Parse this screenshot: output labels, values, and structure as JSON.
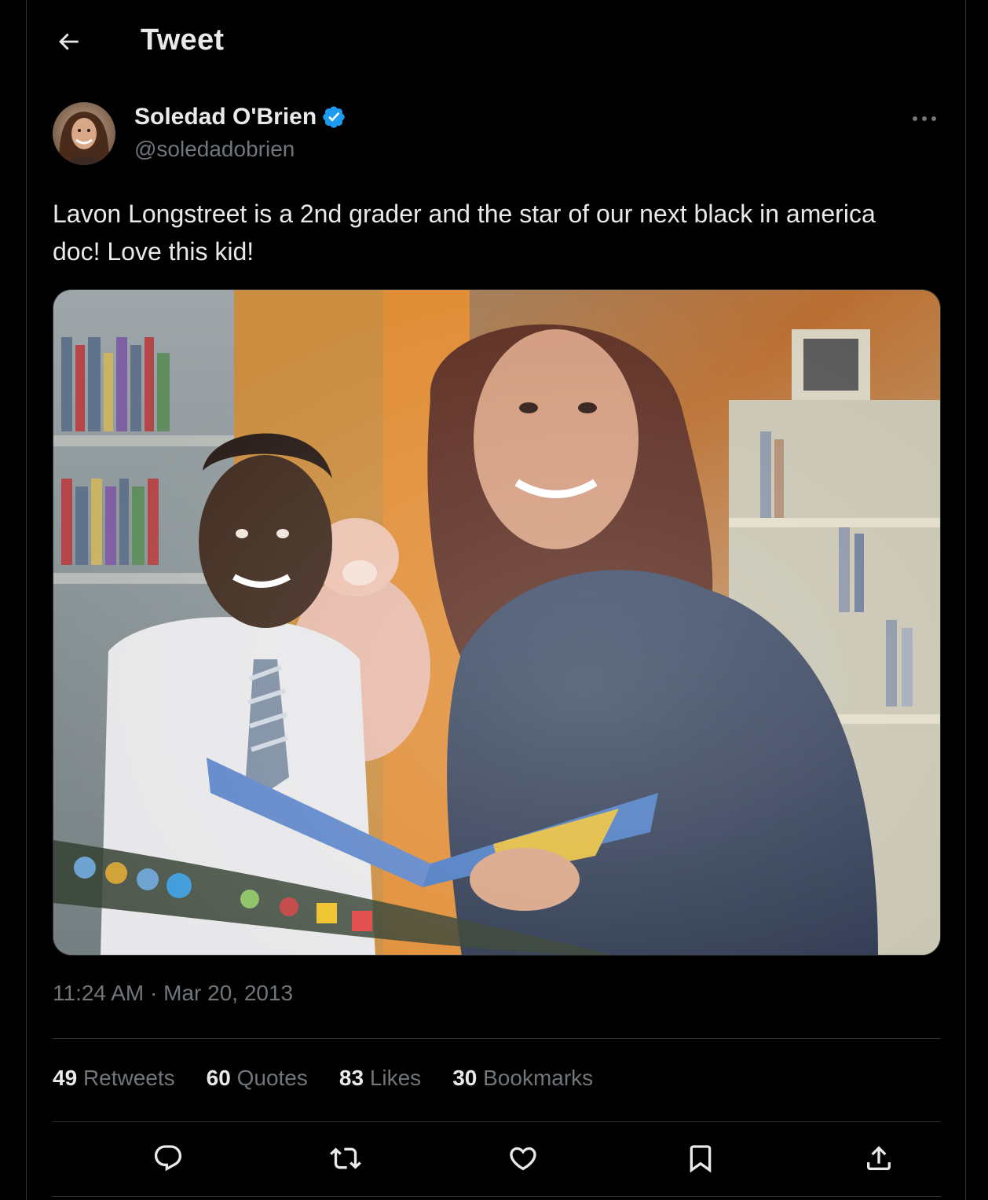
{
  "header": {
    "title": "Tweet",
    "back_icon": "arrow-left-icon"
  },
  "author": {
    "display_name": "Soledad O'Brien",
    "handle": "@soledadobrien",
    "verified": true,
    "verified_color": "#1d9bf0"
  },
  "tweet": {
    "text": "Lavon Longstreet is a 2nd grader and the star of our next black in america doc! Love this kid!",
    "time": "11:24 AM",
    "separator": "·",
    "date": "Mar 20, 2013"
  },
  "stats": [
    {
      "count": "49",
      "label": "Retweets"
    },
    {
      "count": "60",
      "label": "Quotes"
    },
    {
      "count": "83",
      "label": "Likes"
    },
    {
      "count": "30",
      "label": "Bookmarks"
    }
  ],
  "actions": [
    "reply-icon",
    "retweet-icon",
    "like-icon",
    "bookmark-icon",
    "share-icon"
  ],
  "colors": {
    "background": "#000000",
    "text_primary": "#e7e9ea",
    "text_secondary": "#71767b",
    "border": "#2f3336",
    "accent": "#1d9bf0"
  }
}
